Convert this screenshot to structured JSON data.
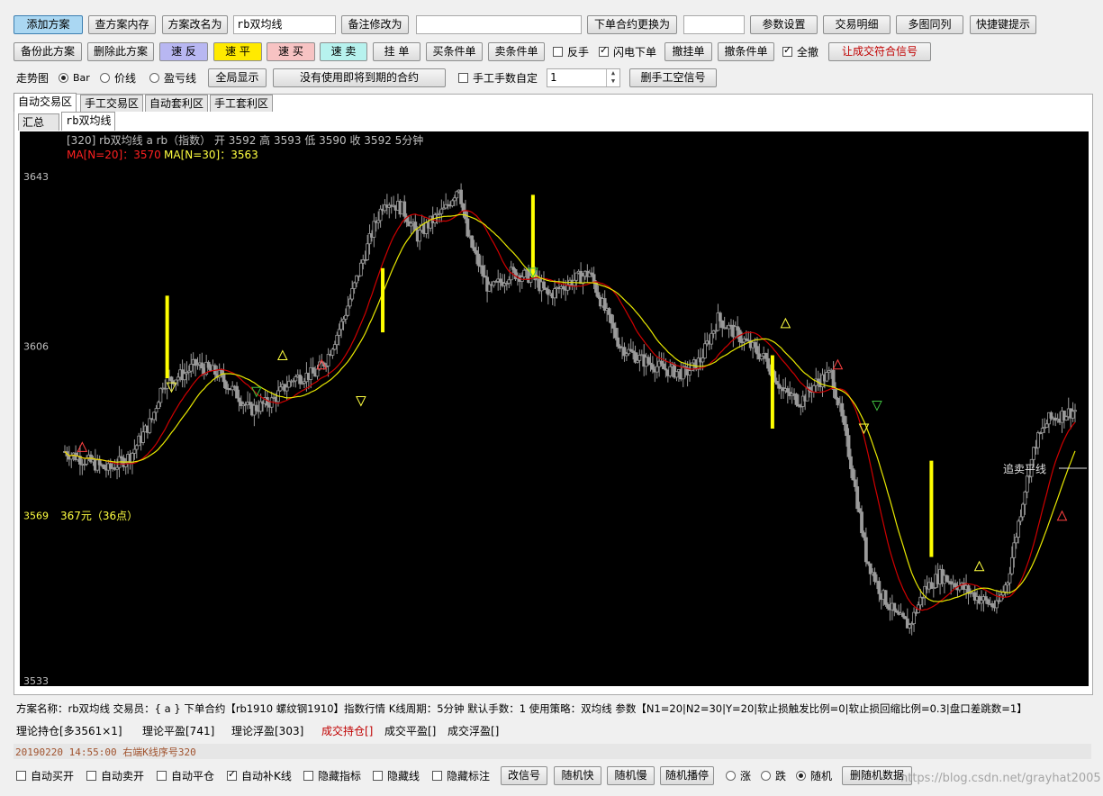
{
  "toolbar1": {
    "add_plan": "添加方案",
    "view_plan_memory": "查方案内存",
    "rename_plan": "方案改名为",
    "plan_name_value": "rb双均线",
    "memo_change": "备注修改为",
    "memo_value": "",
    "change_contract": "下单合约更换为",
    "contract_value": "",
    "param_settings": "参数设置",
    "trade_detail": "交易明细",
    "multi_chart": "多图同列",
    "hotkey_tip": "快捷键提示"
  },
  "toolbar2": {
    "backup_plan": "备份此方案",
    "delete_plan": "删除此方案",
    "quick_reverse": "速 反",
    "quick_flat": "速 平",
    "quick_buy": "速 买",
    "quick_sell": "速 卖",
    "hang_order": "挂 单",
    "buy_condition": "买条件单",
    "sell_condition": "卖条件单",
    "reverse_hand": "反手",
    "flash_order": "闪电下单",
    "cancel_hang": "撤挂单",
    "cancel_condition": "撤条件单",
    "cancel_all": "全撤",
    "match_signal": "让成交符合信号"
  },
  "toolbar3": {
    "trend_label": "走势图",
    "radio_bar": "Bar",
    "radio_price": "价线",
    "radio_pnl": "盈亏线",
    "full_display": "全局显示",
    "no_expiring": "没有使用即将到期的合约",
    "manual_lots": "手工手数自定",
    "lots_value": "1",
    "delete_manual_signal": "删手工空信号"
  },
  "tabs": [
    "自动交易区",
    "手工交易区",
    "自动套利区",
    "手工套利区"
  ],
  "subtabs": [
    "汇总",
    "rb双均线"
  ],
  "chart_data": {
    "type": "candlestick",
    "header": "[320]  rb双均线   a   rb（指数）   开 3592   高 3593   低 3590   收 3592   5分钟",
    "ma1_label": "MA[N=20]：3570",
    "ma2_label": "MA[N=30]：3563",
    "y_ticks": [
      3643,
      3606,
      3569,
      3533
    ],
    "ylim": [
      3533,
      3651
    ],
    "profit_note": "367元（36点）",
    "annotation": "追卖平线",
    "colors": {
      "ma1": "#d00000",
      "ma2": "#e8e800",
      "candle": "#9a9a9a",
      "signal": "#ffff00",
      "axis_text": "#c0c0c0",
      "header_text": "#c0c0c0"
    }
  },
  "info": {
    "line1": "方案名称：rb双均线   交易员：{ a }   下单合约【rb1910 螺纹钢1910】指数行情   K线周期：5分钟   默认手数：1   使用策略：双均线   参数【N1=20|N2=30|Y=20|软止损触发比例=0|软止损回缩比例=0.3|盘口差跳数=1】",
    "position": "理论持仓[多3561×1]",
    "theory_flat": "理论平盈[741]",
    "theory_float": "理论浮盈[303]",
    "real_position": "成交持仓[]",
    "real_flat": "成交平盈[]",
    "real_float": "成交浮盈[]",
    "status": "20190220 14:55:00   右端K线序号320"
  },
  "bottom": {
    "auto_buy": "自动买开",
    "auto_sell": "自动卖开",
    "auto_flat": "自动平仓",
    "auto_fill": "自动补K线",
    "hide_indicator": "隐藏指标",
    "hide_line": "隐藏线",
    "hide_mark": "隐藏标注",
    "change_signal": "改信号",
    "random_fast": "随机快",
    "random_slow": "随机慢",
    "random_pause": "随机播停",
    "radio_up": "涨",
    "radio_down": "跌",
    "radio_random": "随机",
    "delete_random": "删随机数据",
    "watermark": "https://blog.csdn.net/grayhat2005"
  }
}
